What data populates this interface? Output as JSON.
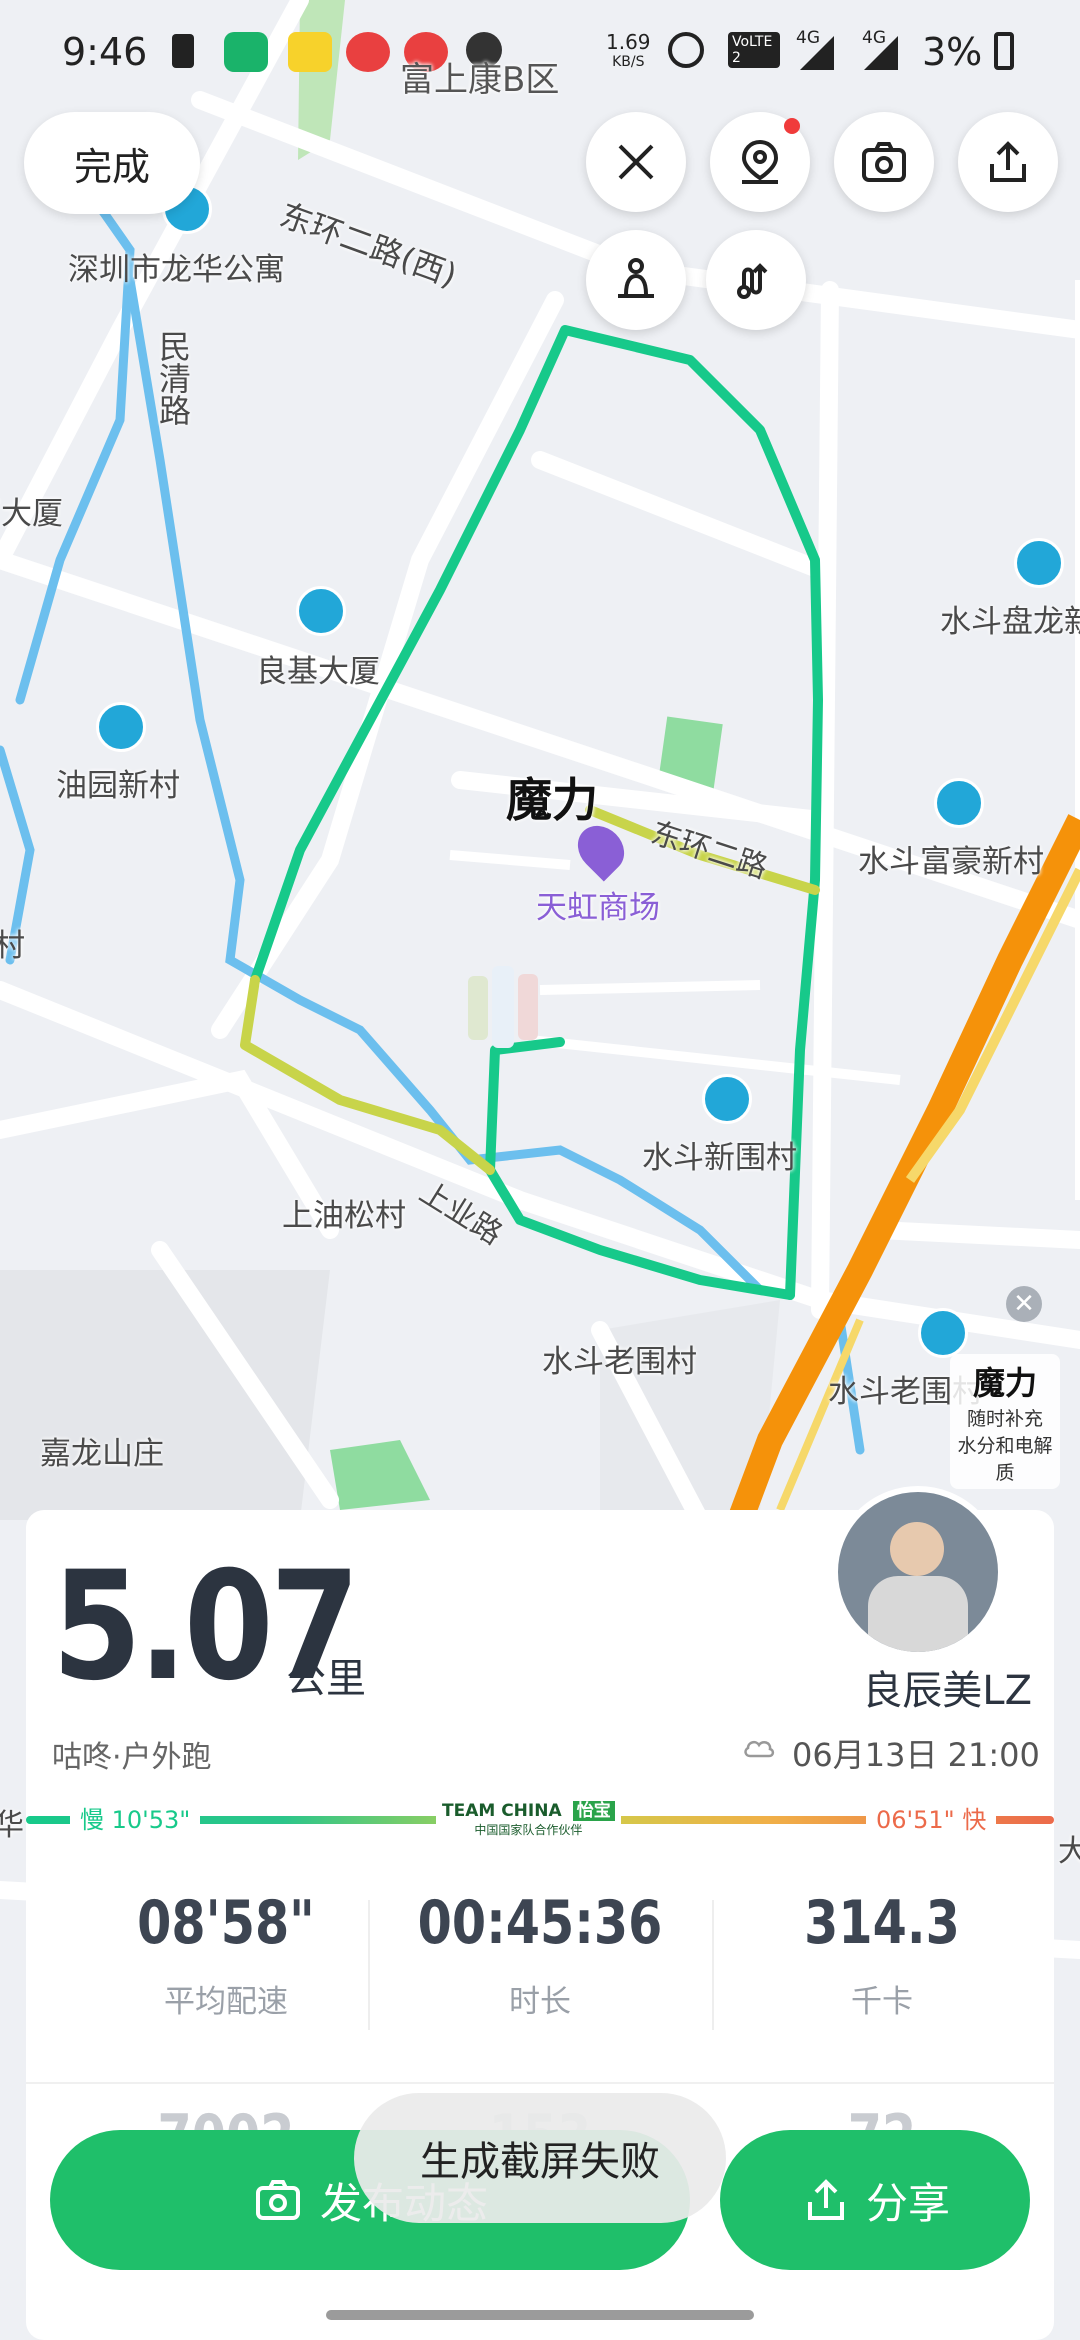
{
  "status_bar": {
    "time": "9:46",
    "net_speed_value": "1.69",
    "net_speed_unit": "KB/S",
    "volte_label": "VoLTE 2",
    "signal_1": "4G",
    "signal_2": "4G",
    "battery": "3%"
  },
  "map": {
    "labels": {
      "area_top": "富上康B区",
      "road_dh_west": "东环二路(西)",
      "apartment": "深圳市龙华公寓",
      "road_mq": "民清路",
      "building_left": "厦大厦",
      "liangji": "良基大厦",
      "youyuan": "油园新村",
      "shuidou_panlong": "水斗盘龙新",
      "shuidou_fuhao": "水斗富豪新村",
      "mall": "天虹商场",
      "road_dh2": "东环二路",
      "shuidou_xinwei": "水斗新围村",
      "shangyou": "上油松村",
      "road_sy": "上业路",
      "shuidou_laowei": "水斗老围村",
      "shuidou_laowei2": "水斗老围村",
      "jialong": "嘉龙山庄",
      "edge_cun": "村",
      "edge_hua": "华",
      "edge_da": "大"
    },
    "sponsor_mark": "魔力",
    "ad_title": "魔力",
    "ad_line1": "随时补充",
    "ad_line2": "水分和电解质"
  },
  "top_controls": {
    "done_label": "完成"
  },
  "summary": {
    "distance": "5.07",
    "distance_unit": "公里",
    "username": "良辰美LZ",
    "source": "咕咚·户外跑",
    "datetime": "06月13日 21:00",
    "pace_slow": "慢 10'53\"",
    "pace_fast": "06'51\" 快",
    "team_logo_1": "TEAM CHINA",
    "team_logo_2": "怡宝",
    "team_logo_sub": "中国国家队合作伙伴",
    "stats": [
      {
        "value": "08'58\"",
        "label": "平均配速"
      },
      {
        "value": "00:45:36",
        "label": "时长"
      },
      {
        "value": "314.3",
        "label": "千卡"
      }
    ],
    "partial_stats": [
      "7002",
      "153",
      "72"
    ]
  },
  "actions": {
    "publish_label": "发布动态",
    "share_label": "分享"
  },
  "toast": "生成截屏失败",
  "colors": {
    "brand_green": "#1fbf6a",
    "route_green": "#17c98a",
    "route_yellow": "#c8d44a",
    "highway_orange": "#f5920a",
    "water_blue": "#6cbfee"
  }
}
